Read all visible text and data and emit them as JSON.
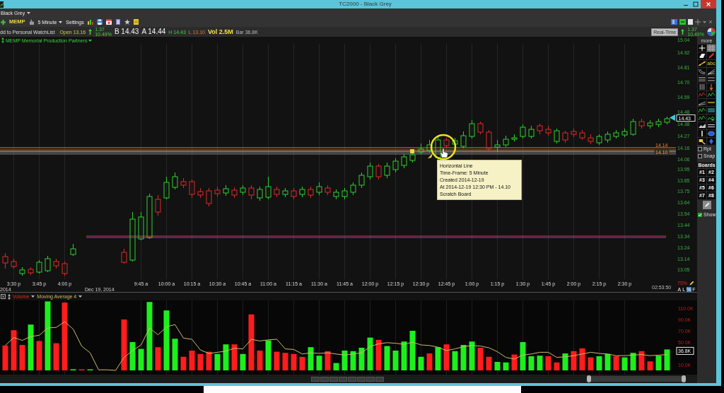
{
  "window": {
    "title": "TC2000 - Black Grey"
  },
  "menu": {
    "layout": "Black Grey"
  },
  "toolbar": {
    "symbol": "MEMP",
    "timeframe": "5 Minute",
    "settings": "Settings"
  },
  "quote": {
    "watchlist": "dd to Personal WatchList",
    "open": "Open 13.16",
    "change": "1.37",
    "change_percent": "10.49%",
    "bid": "B 14.43",
    "ask": "A 14.44",
    "high": "H 14.43",
    "low": "L 13.10",
    "volume": "Vol 2.5M",
    "bar_volume": "Bar 36.8K"
  },
  "realtime": {
    "label": "Real-Time",
    "change": "1.37",
    "change_percent": "10.49%"
  },
  "price_chart": {
    "title": "MEMP Memorial Production Partners",
    "price_ticks": [
      "15.04",
      "14.92",
      "14.81",
      "14.70",
      "14.59",
      "14.48",
      "14.38",
      "14.27",
      "14.16",
      "14.06",
      "13.95",
      "13.85",
      "13.75",
      "13.64",
      "13.54",
      "13.44",
      "13.34",
      "13.24",
      "13.14",
      "13.05"
    ],
    "last_price": "14.43",
    "line_labels": [
      "14.14",
      "14.10"
    ],
    "tooltip": [
      "Horizontal Line",
      "Time-Frame: 5 Minute",
      "Created 2014-12-19",
      "At 2014-12-19 12:30 PM - 14.10",
      "Scratch Board"
    ]
  },
  "time_axis": {
    "dates": [
      "2014",
      "Dec 19, 2014"
    ],
    "clock": "02:53:50"
  },
  "axis_controls": {
    "zoom": "75%",
    "scale_modes": [
      {
        "label": "A",
        "selected": false
      },
      {
        "label": "L",
        "selected": false
      },
      {
        "label": "%",
        "selected": true
      },
      {
        "label": "F",
        "selected": false
      }
    ]
  },
  "volume_panel": {
    "last_value": "36.8K",
    "chart_data": {
      "type": "bar",
      "grid": true,
      "categories": [
        null,
        "3:30 p",
        null,
        null,
        "3:45 p",
        null,
        null,
        "4:00 p",
        null,
        null,
        null,
        null,
        null,
        null,
        null,
        null,
        "9:45 a",
        null,
        null,
        "10:00 a",
        null,
        null,
        "10:15 a",
        null,
        null,
        "10:30 a",
        null,
        null,
        "10:45 a",
        null,
        null,
        "11:00 a",
        null,
        null,
        "11:15 a",
        null,
        null,
        "11:30 a",
        null,
        null,
        "11:45 a",
        null,
        null,
        "12:00 p",
        null,
        null,
        "12:15 p",
        null,
        null,
        "12:30 p",
        null,
        null,
        "12:45 p",
        null,
        null,
        "1:00 p",
        null,
        null,
        "1:15 p",
        null,
        null,
        "1:30 p",
        null,
        null,
        "1:45 p",
        null,
        null,
        "2:00 p",
        null,
        null,
        "2:15 p",
        null,
        null,
        "2:30 p",
        null,
        null,
        null,
        null,
        null
      ],
      "ylim": [
        0,
        123.75
      ],
      "yticks": [
        {
          "value": 10,
          "label": "10.0K"
        },
        {
          "value": 50,
          "label": "50.0K"
        },
        {
          "value": 70,
          "label": "70.0K"
        },
        {
          "value": 90,
          "label": "90.0K"
        },
        {
          "value": 110,
          "label": "110.0K"
        }
      ],
      "series": [
        {
          "name": "Volume",
          "type": "bar",
          "color": "#ff1c1c",
          "values": [
            44,
            71,
            45,
            null,
            52,
            null,
            48,
            120,
            null,
            1,
            null,
            null,
            null,
            null,
            90,
            null,
            null,
            null,
            41,
            null,
            null,
            24,
            35,
            29,
            33,
            null,
            null,
            46,
            null,
            99,
            35,
            null,
            33,
            31,
            29,
            24,
            null,
            null,
            34,
            null,
            null,
            null,
            null,
            null,
            54,
            null,
            null,
            null,
            null,
            null,
            30,
            null,
            46,
            null,
            null,
            null,
            40,
            24,
            null,
            null,
            28,
            null,
            null,
            null,
            25,
            14,
            null,
            34,
            39,
            23,
            null,
            null,
            25,
            null,
            null,
            34,
            16,
            null,
            null
          ]
        },
        {
          "type": "bar",
          "color": "#1cf01c",
          "values": [
            null,
            null,
            null,
            81,
            null,
            122,
            null,
            null,
            2,
            null,
            1,
            null,
            null,
            null,
            null,
            50,
            38,
            121,
            null,
            106,
            56,
            null,
            null,
            null,
            null,
            29,
            46,
            null,
            29,
            null,
            null,
            53,
            null,
            null,
            null,
            null,
            41,
            26,
            null,
            13,
            35,
            34,
            40,
            58,
            null,
            43,
            35,
            51,
            70,
            24,
            null,
            41,
            null,
            34,
            45,
            51,
            null,
            null,
            15,
            14,
            null,
            50,
            25,
            26,
            null,
            null,
            30,
            null,
            null,
            null,
            25,
            29,
            null,
            23,
            31,
            null,
            null,
            26,
            37
          ]
        },
        {
          "name": "Moving Average 4",
          "type": "line",
          "color": "#cdbb6a",
          "values": [
            44,
            58,
            53,
            60,
            62,
            75,
            76,
            86,
            73,
            43,
            31,
            1,
            1,
            0,
            23,
            35,
            45,
            75,
            63,
            77,
            81,
            57,
            55,
            36,
            30,
            32,
            34,
            39,
            38,
            55,
            52,
            54,
            55,
            38,
            37,
            29,
            31,
            30,
            31,
            29,
            27,
            29,
            31,
            42,
            47,
            49,
            48,
            46,
            50,
            45,
            44,
            41,
            35,
            38,
            42,
            44,
            43,
            40,
            33,
            23,
            20,
            27,
            29,
            32,
            32,
            23,
            24,
            26,
            29,
            32,
            30,
            29,
            26,
            26,
            27,
            28,
            26,
            27,
            28
          ]
        }
      ]
    }
  },
  "tool_panel": {
    "title": "more",
    "text_tool": "abc",
    "options": [
      {
        "label": "Rpt",
        "checked": false
      },
      {
        "label": "Snap",
        "checked": false
      }
    ],
    "boards_title": "Boards",
    "boards": [
      "#1",
      "#2",
      "#3",
      "#4",
      "#5",
      "#6",
      "#7",
      "#8"
    ],
    "show": {
      "label": "Show",
      "checked": true
    }
  }
}
